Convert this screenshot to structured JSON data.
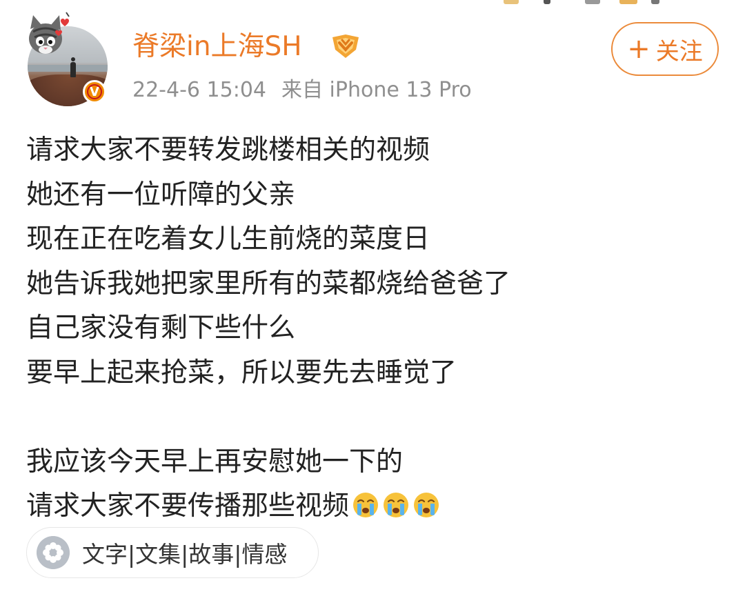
{
  "post": {
    "author": {
      "name": "脊梁in上海SH",
      "verified": true,
      "avatar_icon": "avatar-photo-with-cat-frame",
      "level_icon": "gold-level-badge-icon",
      "verified_icon": "verified-v-badge-icon"
    },
    "meta": {
      "timestamp": "22-4-6 15:04",
      "source": "来自 iPhone 13 Pro"
    },
    "follow_button": {
      "plus": "+",
      "label": "关注"
    },
    "lines": [
      "请求大家不要转发跳楼相关的视频",
      "她还有一位听障的父亲",
      "现在正在吃着女儿生前烧的菜度日",
      "她告诉我她把家里所有的菜都烧给爸爸了",
      "自己家没有剩下些什么",
      "要早上起来抢菜，所以要先去睡觉了",
      "",
      "我应该今天早上再安慰她一下的",
      "请求大家不要传播那些视频"
    ],
    "trailing_emojis": [
      "crying-face-emoji",
      "crying-face-emoji",
      "crying-face-emoji"
    ],
    "topic": {
      "icon": "flower-icon",
      "label": "文字|文集|故事|情感"
    }
  },
  "colors": {
    "accent_orange": "#eb7a28",
    "meta_gray": "#8f8f8f",
    "body_text": "#222222",
    "badge_orange": "#f08a00"
  }
}
